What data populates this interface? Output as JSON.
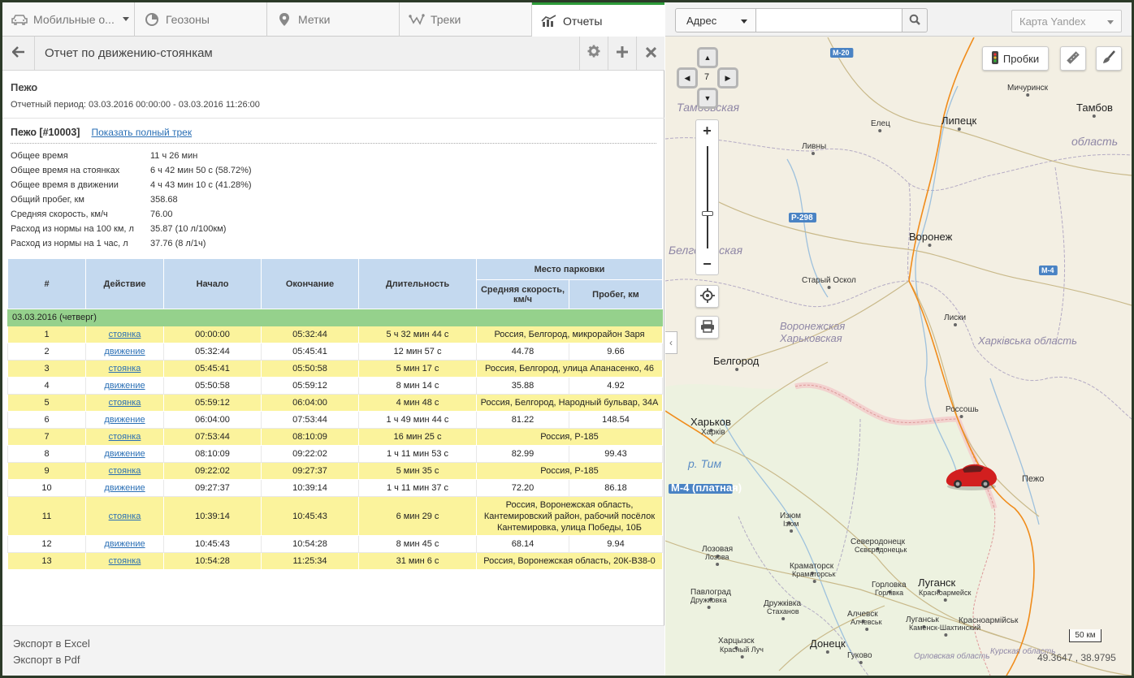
{
  "tabs": [
    {
      "label": "Мобильные о...",
      "icon": "car-icon"
    },
    {
      "label": "Геозоны",
      "icon": "geozone-icon"
    },
    {
      "label": "Метки",
      "icon": "pin-icon"
    },
    {
      "label": "Треки",
      "icon": "track-icon"
    },
    {
      "label": "Отчеты",
      "icon": "chart-icon"
    }
  ],
  "toolbar": {
    "title": "Отчет по движению-стоянкам"
  },
  "report": {
    "object_name": "Пежо",
    "period": "Отчетный период: 03.03.2016 00:00:00 - 03.03.2016 11:26:00",
    "object_id": "Пежо [#10003]",
    "track_link": "Показать полный трек"
  },
  "summary": [
    {
      "k": "Общее время",
      "v": "11 ч 26 мин"
    },
    {
      "k": "Общее время на стоянках",
      "v": "6 ч 42 мин 50 с (58.72%)"
    },
    {
      "k": "Общее время в движении",
      "v": "4 ч 43 мин 10 с (41.28%)"
    },
    {
      "k": "Общий пробег, км",
      "v": "358.68"
    },
    {
      "k": "Средняя скорость, км/ч",
      "v": "76.00"
    },
    {
      "k": "Расход из нормы на 100 км, л",
      "v": "35.87 (10 л/100км)"
    },
    {
      "k": "Расход из нормы на 1 час, л",
      "v": "37.76 (8 л/1ч)"
    }
  ],
  "table": {
    "headers": {
      "num": "#",
      "action": "Действие",
      "start": "Начало",
      "end": "Окончание",
      "duration": "Длительность",
      "parking": "Место парковки",
      "avg_speed": "Средняя скорость, км/ч",
      "distance": "Пробег, км"
    },
    "date_label": "03.03.2016 (четверг)",
    "rows": [
      {
        "n": "1",
        "a": "стоянка",
        "s": "00:00:00",
        "e": "05:32:44",
        "d": "5 ч 32 мин 44 с",
        "place": "Россия, Белгород, микрорайон Заря"
      },
      {
        "n": "2",
        "a": "движение",
        "s": "05:32:44",
        "e": "05:45:41",
        "d": "12 мин 57 с",
        "speed": "44.78",
        "dist": "9.66"
      },
      {
        "n": "3",
        "a": "стоянка",
        "s": "05:45:41",
        "e": "05:50:58",
        "d": "5 мин 17 с",
        "place": "Россия, Белгород, улица Апанасенко, 46"
      },
      {
        "n": "4",
        "a": "движение",
        "s": "05:50:58",
        "e": "05:59:12",
        "d": "8 мин 14 с",
        "speed": "35.88",
        "dist": "4.92"
      },
      {
        "n": "5",
        "a": "стоянка",
        "s": "05:59:12",
        "e": "06:04:00",
        "d": "4 мин 48 с",
        "place": "Россия, Белгород, Народный бульвар, 34А"
      },
      {
        "n": "6",
        "a": "движение",
        "s": "06:04:00",
        "e": "07:53:44",
        "d": "1 ч 49 мин 44 с",
        "speed": "81.22",
        "dist": "148.54"
      },
      {
        "n": "7",
        "a": "стоянка",
        "s": "07:53:44",
        "e": "08:10:09",
        "d": "16 мин 25 с",
        "place": "Россия, Р-185"
      },
      {
        "n": "8",
        "a": "движение",
        "s": "08:10:09",
        "e": "09:22:02",
        "d": "1 ч 11 мин 53 с",
        "speed": "82.99",
        "dist": "99.43"
      },
      {
        "n": "9",
        "a": "стоянка",
        "s": "09:22:02",
        "e": "09:27:37",
        "d": "5 мин 35 с",
        "place": "Россия, Р-185"
      },
      {
        "n": "10",
        "a": "движение",
        "s": "09:27:37",
        "e": "10:39:14",
        "d": "1 ч 11 мин 37 с",
        "speed": "72.20",
        "dist": "86.18"
      },
      {
        "n": "11",
        "a": "стоянка",
        "s": "10:39:14",
        "e": "10:45:43",
        "d": "6 мин 29 с",
        "place": "Россия, Воронежская область, Кантемировский район, рабочий посёлок Кантемировка, улица Победы, 10Б"
      },
      {
        "n": "12",
        "a": "движение",
        "s": "10:45:43",
        "e": "10:54:28",
        "d": "8 мин 45 с",
        "speed": "68.14",
        "dist": "9.94"
      },
      {
        "n": "13",
        "a": "стоянка",
        "s": "10:54:28",
        "e": "11:25:34",
        "d": "31 мин 6 с",
        "place": "Россия, Воронежская область, 20К-В38-0"
      }
    ]
  },
  "footer": {
    "excel": "Экспорт в Excel",
    "pdf": "Экспорт в Pdf"
  },
  "map": {
    "addr_label": "Адрес",
    "addr_value": "",
    "map_type": "Карта Yandex",
    "probki": "Пробки",
    "zoom_level": "7",
    "scale": "50 км",
    "coords": "49.3647 , 38.9795",
    "vehicle_label": "Пежо",
    "labels": [
      {
        "t": "Липецк",
        "cls": "city"
      },
      {
        "t": "Тамбов",
        "cls": "city"
      },
      {
        "t": "Воронеж",
        "cls": "city"
      },
      {
        "t": "Белгород",
        "cls": "city"
      },
      {
        "t": "Харьков",
        "cls": "city"
      },
      {
        "t": "Луганск",
        "cls": "city"
      },
      {
        "t": "Донецк",
        "cls": "city"
      },
      {
        "t": "Мичуринск",
        "cls": "town"
      },
      {
        "t": "Елец",
        "cls": "town"
      },
      {
        "t": "Ливны",
        "cls": "town"
      },
      {
        "t": "Старый Оскол",
        "cls": "town"
      },
      {
        "t": "Лиски",
        "cls": "town"
      },
      {
        "t": "Россошь",
        "cls": "town"
      },
      {
        "t": "Харків",
        "cls": "town"
      },
      {
        "t": "Изюм",
        "cls": "town"
      },
      {
        "t": "Ізюм",
        "cls": "town"
      },
      {
        "t": "Лозовая",
        "cls": "town"
      },
      {
        "t": "Лозова",
        "cls": "town"
      },
      {
        "t": "Северодонецк",
        "cls": "town"
      },
      {
        "t": "Сєвєродонецьк",
        "cls": "town"
      },
      {
        "t": "Краматорск",
        "cls": "town"
      },
      {
        "t": "Краматорськ",
        "cls": "town"
      },
      {
        "t": "Павлоград",
        "cls": "town"
      },
      {
        "t": "Дружковка",
        "cls": "town"
      },
      {
        "t": "Дружківка",
        "cls": "town"
      },
      {
        "t": "Стаханов",
        "cls": "town"
      },
      {
        "t": "Горловка",
        "cls": "town"
      },
      {
        "t": "Горлівка",
        "cls": "town"
      },
      {
        "t": "Алчевск",
        "cls": "town"
      },
      {
        "t": "Алчевськ",
        "cls": "town"
      },
      {
        "t": "Луганськ",
        "cls": "town"
      },
      {
        "t": "Каменск-Шахтинский",
        "cls": "town"
      },
      {
        "t": "Красноармейск",
        "cls": "town"
      },
      {
        "t": "Красноармійськ",
        "cls": "town"
      },
      {
        "t": "Харцызск",
        "cls": "town"
      },
      {
        "t": "Красный Луч",
        "cls": "town"
      },
      {
        "t": "Гуково",
        "cls": "town"
      },
      {
        "t": "Орловская область",
        "cls": "region"
      },
      {
        "t": "Курская область",
        "cls": "region"
      },
      {
        "t": "Тамбовская",
        "cls": "region"
      },
      {
        "t": "Белгородская",
        "cls": "region"
      },
      {
        "t": "область",
        "cls": "region"
      },
      {
        "t": "Воронежская",
        "cls": "region"
      },
      {
        "t": "Харьковская",
        "cls": "region"
      },
      {
        "t": "Харківська область",
        "cls": "region"
      },
      {
        "t": "р. Тим",
        "cls": "river"
      },
      {
        "t": "М-4 (платная)",
        "cls": "road"
      },
      {
        "t": "Р-298",
        "cls": "road"
      },
      {
        "t": "М-20",
        "cls": "road"
      },
      {
        "t": "М-4",
        "cls": "road"
      }
    ]
  }
}
